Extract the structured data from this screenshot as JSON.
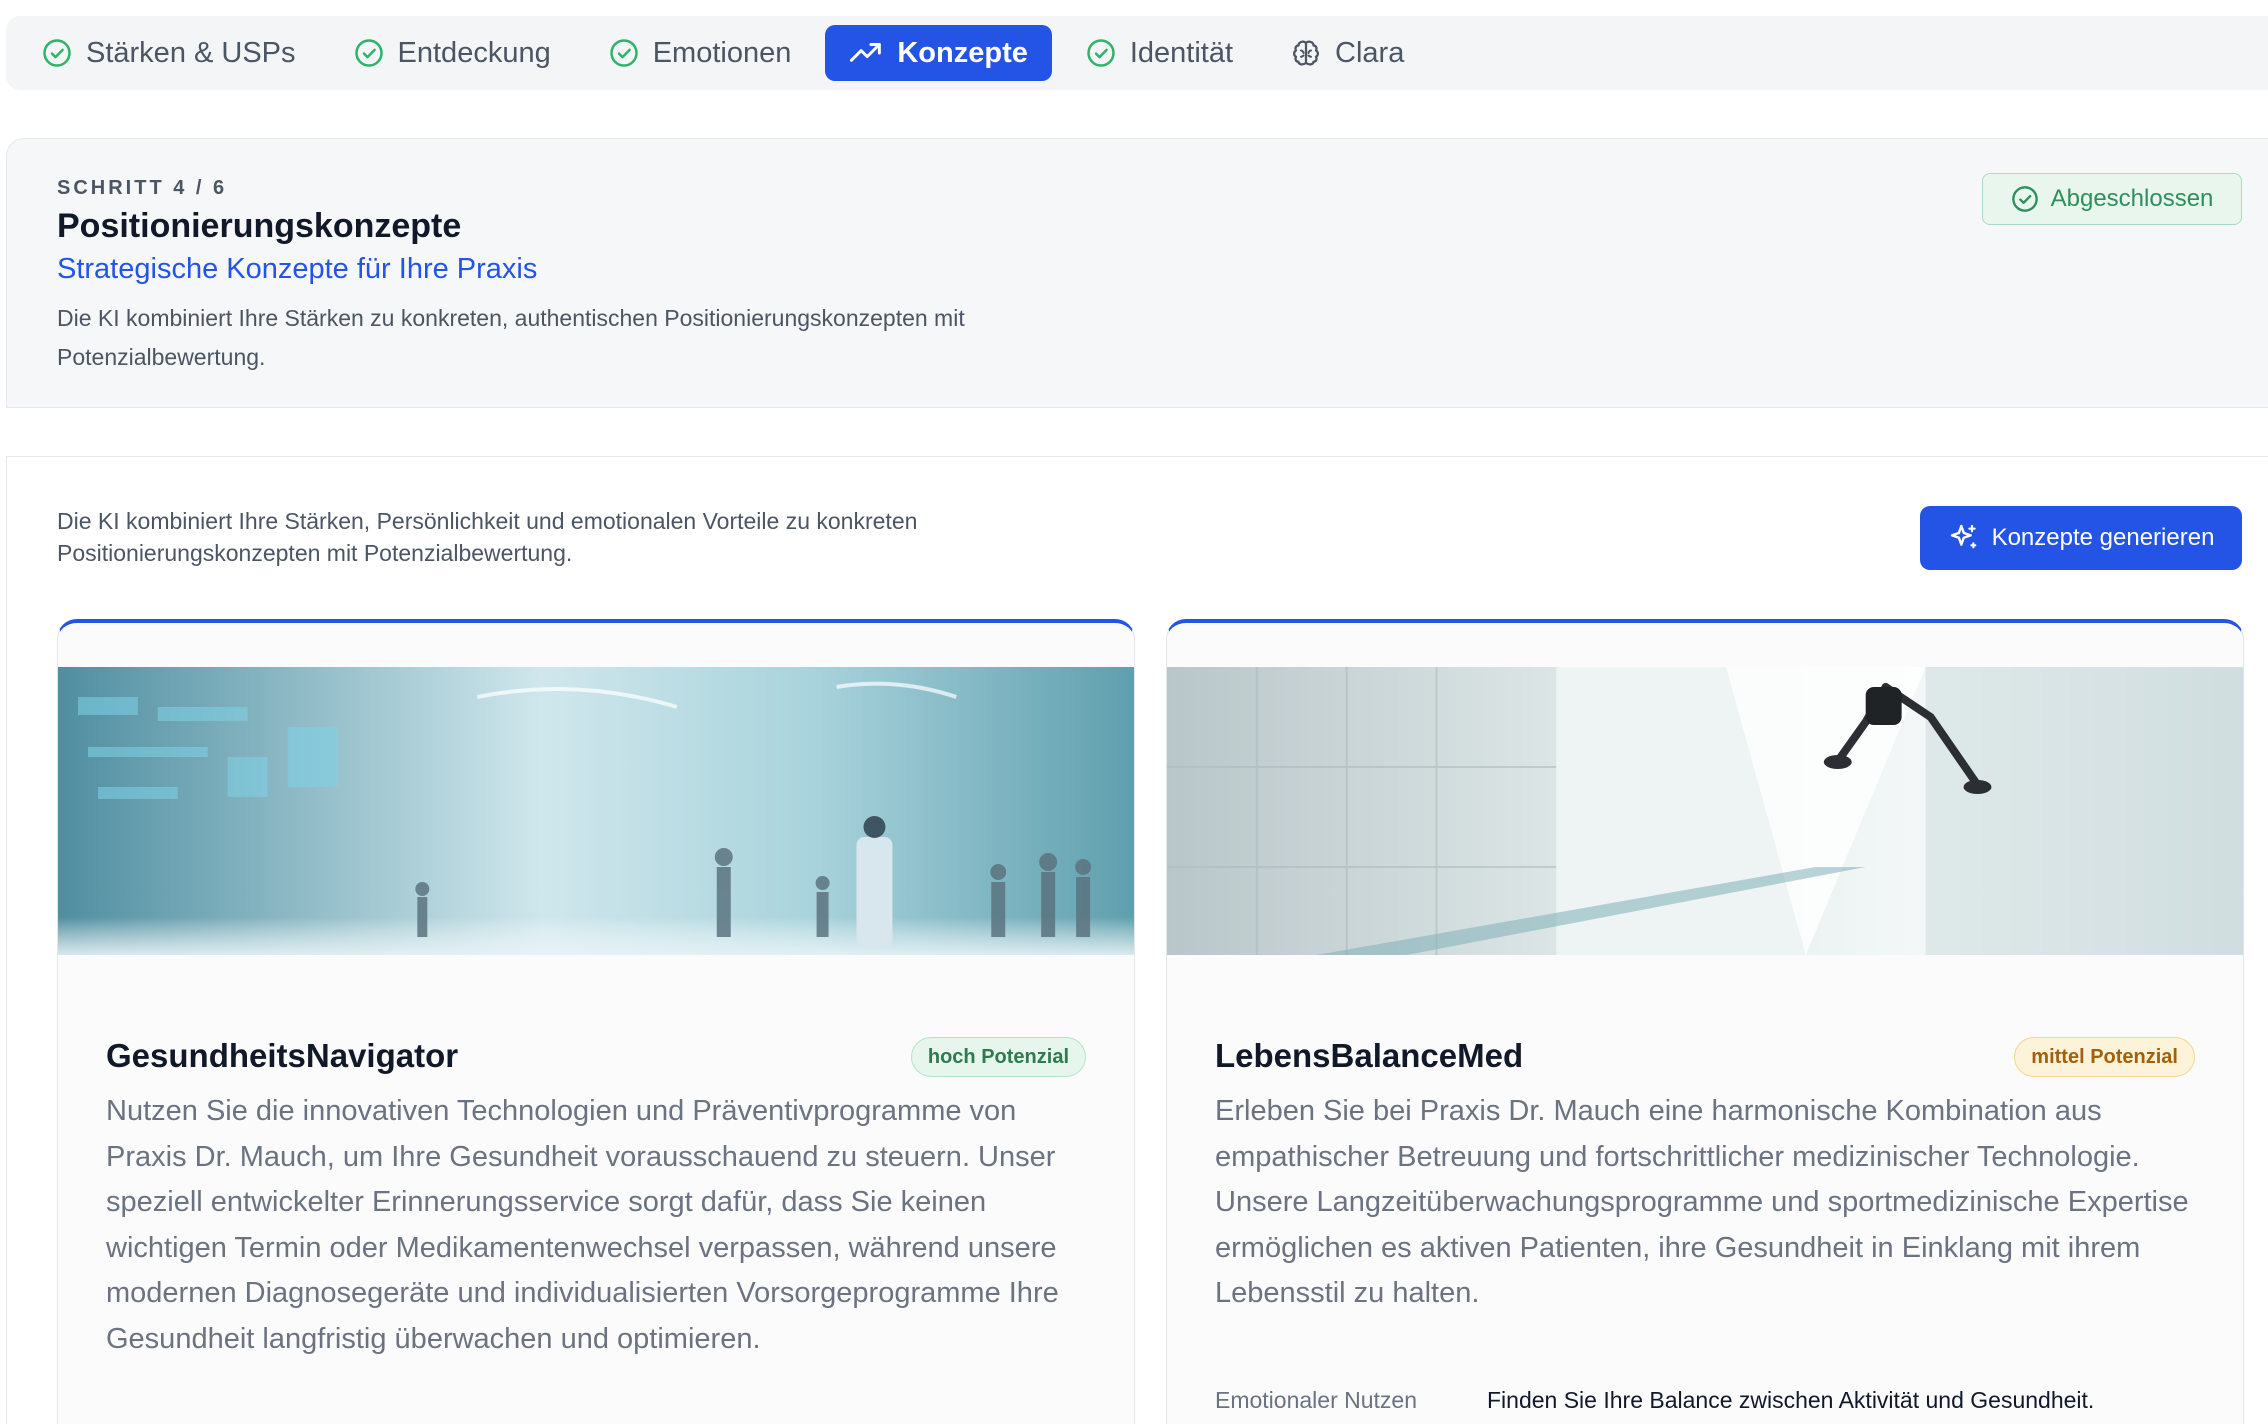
{
  "tabs": [
    {
      "label": "Stärken & USPs",
      "icon": "check-circle-icon",
      "state": "done"
    },
    {
      "label": "Entdeckung",
      "icon": "check-circle-icon",
      "state": "done"
    },
    {
      "label": "Emotionen",
      "icon": "check-circle-icon",
      "state": "done"
    },
    {
      "label": "Konzepte",
      "icon": "trending-up-icon",
      "state": "active"
    },
    {
      "label": "Identität",
      "icon": "check-circle-icon",
      "state": "done"
    },
    {
      "label": "Clara",
      "icon": "brain-icon",
      "state": "default"
    }
  ],
  "header": {
    "step": "SCHRITT 4 / 6",
    "title": "Positionierungskonzepte",
    "subtitle": "Strategische Konzepte für Ihre Praxis",
    "description": "Die KI kombiniert Ihre Stärken zu konkreten, authentischen Positionierungskonzepten mit Potenzialbewertung.",
    "status": "Abgeschlossen"
  },
  "main": {
    "intro": "Die KI kombiniert Ihre Stärken, Persönlichkeit und emotionalen Vorteile zu konkreten Positionierungskonzepten mit Potenzialbewertung.",
    "generate_label": "Konzepte generieren"
  },
  "concepts": [
    {
      "title": "GesundheitsNavigator",
      "potential": "hoch Potenzial",
      "text": "Nutzen Sie die innovativen Technologien und Präventivprogramme von Praxis Dr. Mauch, um Ihre Gesundheit vorausschauend zu steuern. Unser speziell entwickelter Erinnerungsservice sorgt dafür, dass Sie keinen wichtigen Termin oder Medikamentenwechsel verpassen, während unsere modernen Diagnosegeräte und individualisierten Vorsorgeprogramme Ihre Gesundheit langfristig überwachen und optimieren."
    },
    {
      "title": "LebensBalanceMed",
      "potential": "mittel Potenzial",
      "text": "Erleben Sie bei Praxis Dr. Mauch eine harmonische Kombination aus empathischer Betreuung und fortschrittlicher medizinischer Technologie. Unsere Langzeitüberwachungsprogramme und sportmedizinische Expertise ermöglichen es aktiven Patienten, ihre Gesundheit in Einklang mit ihrem Lebensstil zu halten.",
      "emotional_label": "Emotionaler Nutzen",
      "emotional_value": "Finden Sie Ihre Balance zwischen Aktivität und Gesundheit."
    }
  ],
  "colors": {
    "accent": "#2354e6",
    "success": "#2f8f5b",
    "warning": "#a35f0a"
  }
}
